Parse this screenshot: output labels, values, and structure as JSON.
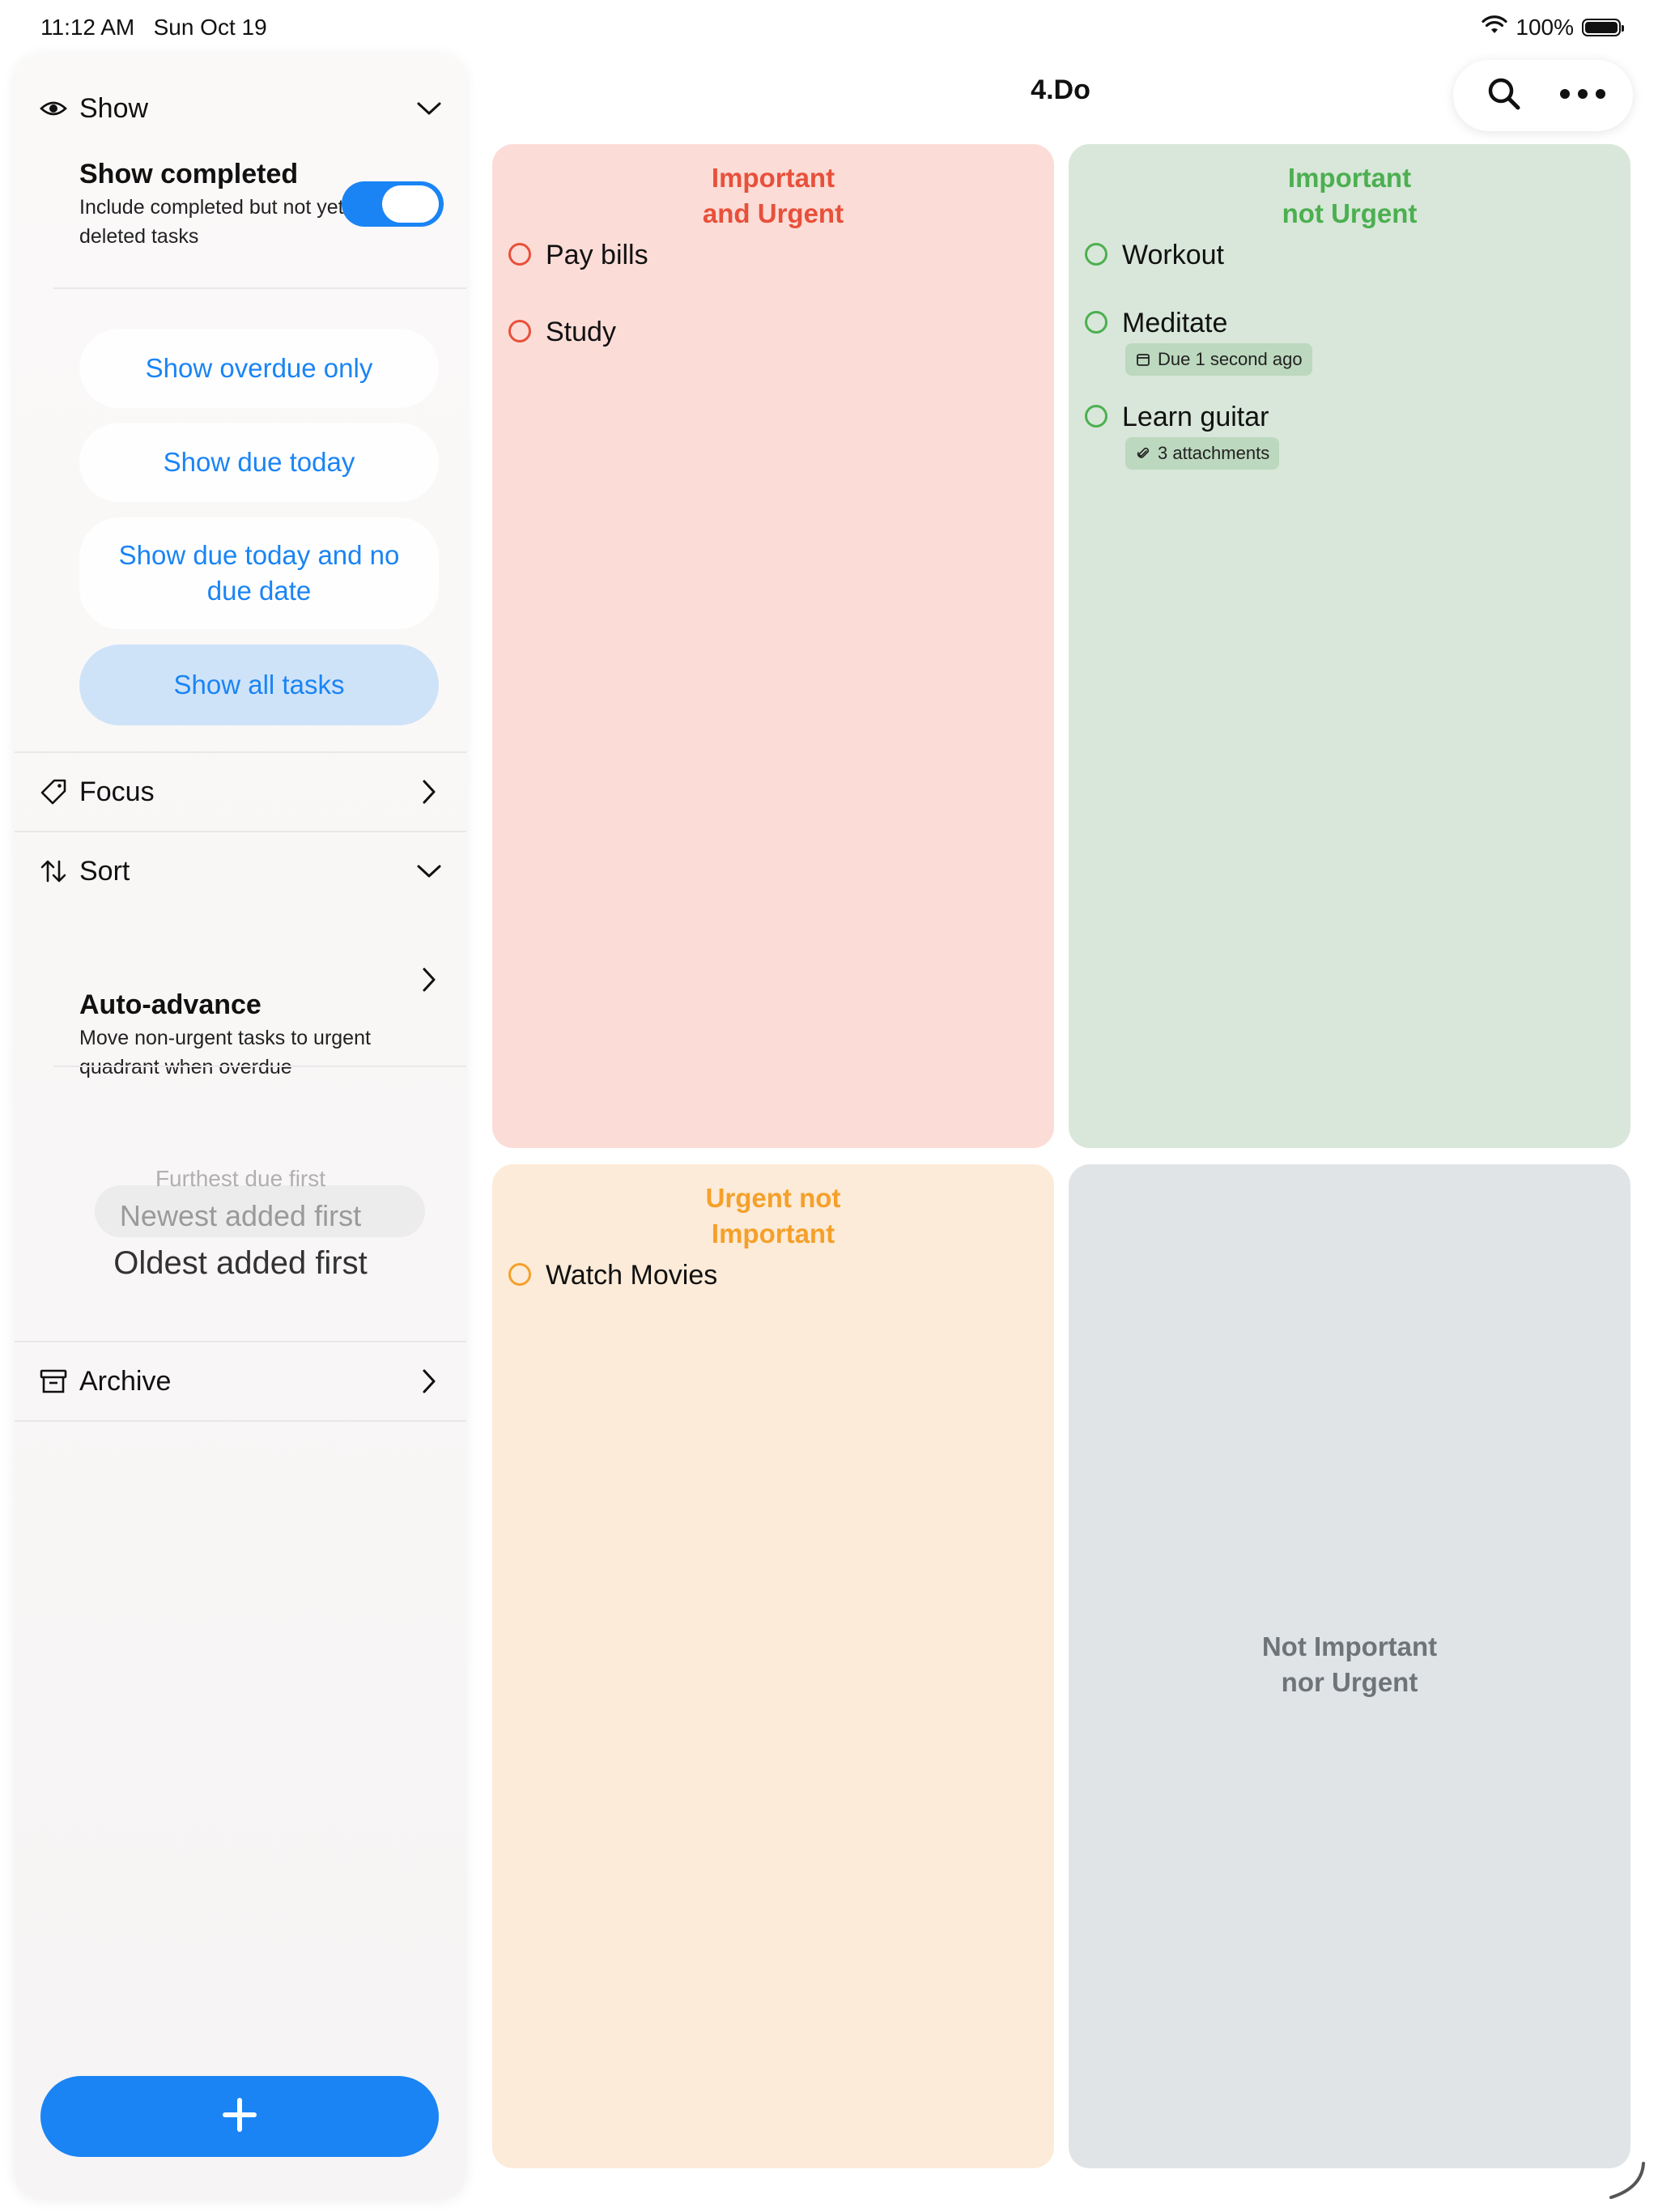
{
  "status_bar": {
    "time": "11:12 AM",
    "date": "Sun Oct 19",
    "battery": "100%"
  },
  "app": {
    "title": "4.Do"
  },
  "toolbar": {
    "search_icon": "search-icon",
    "more_icon": "ellipsis-icon"
  },
  "sidebar": {
    "show_section": {
      "label": "Show"
    },
    "show_completed": {
      "title": "Show completed",
      "description": "Include completed but not yet deleted tasks",
      "enabled": true
    },
    "filters": [
      {
        "label": "Show overdue only",
        "selected": false
      },
      {
        "label": "Show due today",
        "selected": false
      },
      {
        "label": "Show due today and no due date",
        "selected": false
      },
      {
        "label": "Show all tasks",
        "selected": true
      }
    ],
    "focus_section": {
      "label": "Focus"
    },
    "sort_section": {
      "label": "Sort"
    },
    "auto_advance": {
      "title": "Auto-advance",
      "description": "Move non-urgent tasks to urgent quadrant when overdue"
    },
    "sort_picker": {
      "options": [
        "Furthest due first",
        "Newest added first",
        "Oldest added first"
      ],
      "selected": "Oldest added first"
    },
    "archive_section": {
      "label": "Archive"
    },
    "add_button": {
      "icon": "plus-icon"
    }
  },
  "quadrants": {
    "important_urgent": {
      "title_line1": "Important",
      "title_line2": "and Urgent",
      "color": "#e8503a",
      "background": "#fbdcd7",
      "tasks": [
        {
          "name": "Pay bills"
        },
        {
          "name": "Study"
        }
      ]
    },
    "important_not_urgent": {
      "title_line1": "Important",
      "title_line2": "not Urgent",
      "color": "#4caf50",
      "background": "#d8e7d9",
      "tasks": [
        {
          "name": "Workout"
        },
        {
          "name": "Meditate",
          "badge": "Due 1 second ago",
          "badge_icon": "calendar-icon"
        },
        {
          "name": "Learn guitar",
          "badge": "3 attachments",
          "badge_icon": "paperclip-icon"
        }
      ]
    },
    "urgent_not_important": {
      "title_line1": "Urgent not",
      "title_line2": "Important",
      "color": "#f5a02a",
      "background": "#fcebd8",
      "tasks": [
        {
          "name": "Watch Movies"
        }
      ]
    },
    "not_important_not_urgent": {
      "title_line1": "Not Important",
      "title_line2": "nor Urgent",
      "color": "#6f7478",
      "background": "#e0e4e7",
      "tasks": []
    }
  }
}
